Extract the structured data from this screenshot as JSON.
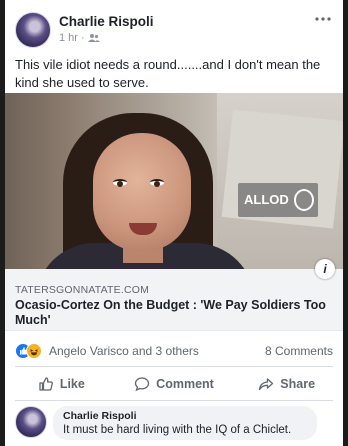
{
  "post": {
    "author": "Charlie Rispoli",
    "time": "1 hr",
    "separator": "·",
    "text": "This vile idiot needs a round.......and I don't mean the kind she used to serve."
  },
  "media": {
    "watermark": "ALLOD",
    "info_icon": "i"
  },
  "link": {
    "domain": "TATERSGONNATATE.COM",
    "title": "Ocasio-Cortez On the Budget : 'We Pay Soldiers Too Much'"
  },
  "reactions": {
    "names": "Angelo Varisco and 3 others",
    "comments": "8 Comments",
    "icons": [
      "like-reaction",
      "haha-reaction"
    ]
  },
  "actions": {
    "like": "Like",
    "comment": "Comment",
    "share": "Share"
  },
  "comment": {
    "author": "Charlie Rispoli",
    "text": "It must be hard living with the IQ of a Chiclet."
  },
  "colors": {
    "link_blue": "#1877f2",
    "text": "#1d2129",
    "muted": "#606770",
    "haha": "#f7b125"
  }
}
